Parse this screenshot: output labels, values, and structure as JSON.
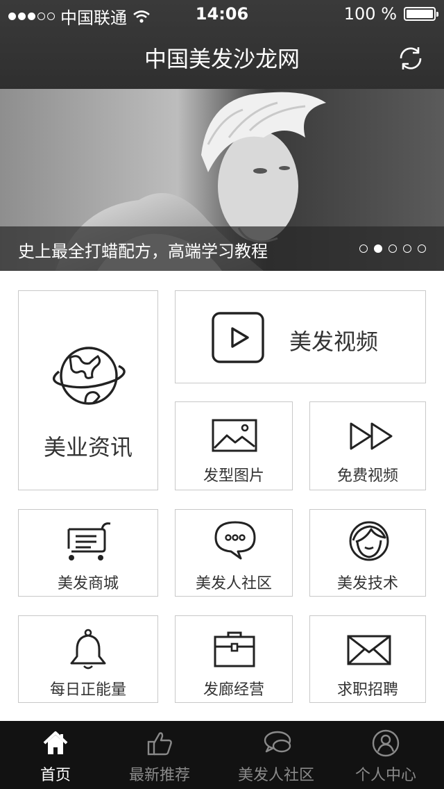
{
  "status_bar": {
    "carrier": "中国联通",
    "time": "14:06",
    "battery": "100 %"
  },
  "header": {
    "title": "中国美发沙龙网"
  },
  "banner": {
    "caption": "史上最全打蜡配方，高端学习教程",
    "pages": 5,
    "active_page": 2
  },
  "tiles": {
    "news": "美业资讯",
    "video": "美发视频",
    "photos": "发型图片",
    "free_video": "免费视频",
    "mall": "美发商城",
    "community": "美发人社区",
    "tech": "美发技术",
    "energy": "每日正能量",
    "business": "发廊经营",
    "jobs": "求职招聘"
  },
  "tabbar": {
    "items": [
      {
        "label": "首页",
        "icon": "home-icon",
        "active": true
      },
      {
        "label": "最新推荐",
        "icon": "thumbs-up-icon",
        "active": false
      },
      {
        "label": "美发人社区",
        "icon": "chat-bubbles-icon",
        "active": false
      },
      {
        "label": "个人中心",
        "icon": "user-icon",
        "active": false
      }
    ]
  },
  "colors": {
    "header_bg": "#333333",
    "tabbar_bg": "#121212",
    "tile_border": "#c8c8c8",
    "active_tab": "#ffffff",
    "inactive_tab": "#8a8a8a"
  }
}
